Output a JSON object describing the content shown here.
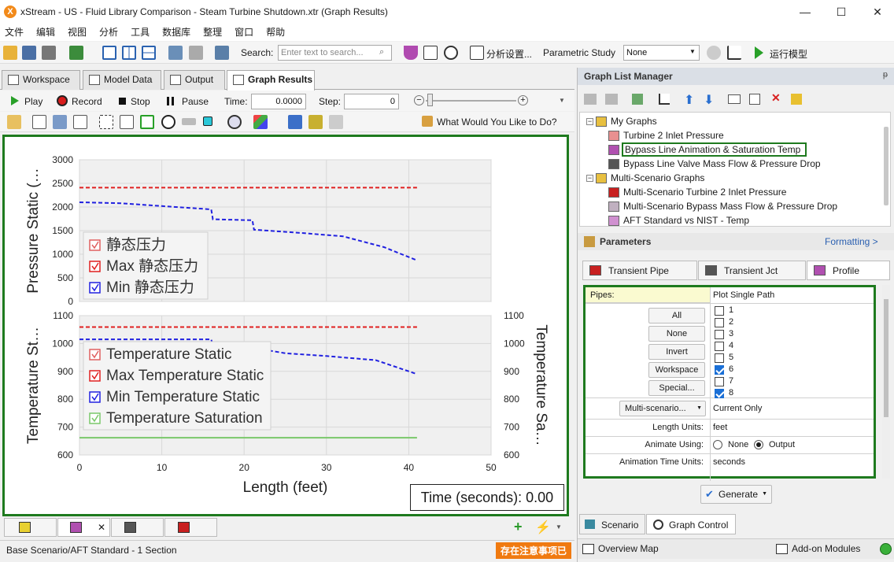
{
  "window": {
    "title": "xStream - US - Fluid Library Comparison - Steam Turbine Shutdown.xtr (Graph Results)",
    "app_icon_letter": "X",
    "min": "—",
    "max": "☐",
    "close": "✕"
  },
  "menu": [
    "文件",
    "编辑",
    "视图",
    "分析",
    "工具",
    "数据库",
    "整理",
    "窗口",
    "帮助"
  ],
  "toolbar": {
    "search_label": "Search:",
    "search_placeholder": "Enter text to search...",
    "analysis_settings": "分析设置...",
    "parametric_label": "Parametric Study",
    "parametric_value": "None",
    "run_model": "运行模型"
  },
  "tabs": [
    {
      "label": "Workspace"
    },
    {
      "label": "Model Data"
    },
    {
      "label": "Output"
    },
    {
      "label": "Graph Results"
    }
  ],
  "playbar": {
    "play": "Play",
    "record": "Record",
    "stop": "Stop",
    "pause": "Pause",
    "time_label": "Time:",
    "time_value": "0.0000",
    "step_label": "Step:",
    "step_value": "0"
  },
  "graph_tools": {
    "help_text": "What Would You Like to Do?"
  },
  "chart_data": [
    {
      "type": "line",
      "ylabel": "Pressure Static (…",
      "ylim": [
        0,
        3000
      ],
      "yticks": [
        "0",
        "500",
        "1000",
        "1500",
        "2000",
        "2500",
        "3000"
      ],
      "xlim": [
        0,
        50
      ],
      "series": [
        {
          "name": "静态压力",
          "color": "#e06060",
          "points": []
        },
        {
          "name": "Max 静态压力",
          "color": "#e02020",
          "points": [
            [
              0,
              2410
            ],
            [
              41,
              2410
            ]
          ]
        },
        {
          "name": "Min 静态压力",
          "color": "#2020e0",
          "points": [
            [
              0,
              2100
            ],
            [
              5,
              2080
            ],
            [
              10,
              2020
            ],
            [
              16,
              1950
            ],
            [
              16.2,
              1740
            ],
            [
              21,
              1720
            ],
            [
              21.2,
              1520
            ],
            [
              27,
              1450
            ],
            [
              32,
              1380
            ],
            [
              37,
              1150
            ],
            [
              41,
              870
            ]
          ]
        }
      ],
      "legend": [
        "静态压力",
        "Max 静态压力",
        "Min 静态压力"
      ]
    },
    {
      "type": "line",
      "ylabel": "Temperature St…",
      "ylabel_right": "Temperature Sa…",
      "ylim": [
        600,
        1100
      ],
      "yticks": [
        "600",
        "700",
        "800",
        "900",
        "1000",
        "1100"
      ],
      "xlim": [
        0,
        50
      ],
      "xticks": [
        "0",
        "10",
        "20",
        "30",
        "40",
        "50"
      ],
      "xlabel": "Length (feet)",
      "series": [
        {
          "name": "Temperature Static",
          "color": "#e06060",
          "points": []
        },
        {
          "name": "Max Temperature Static",
          "color": "#e02020",
          "points": [
            [
              0,
              1059
            ],
            [
              41,
              1059
            ]
          ]
        },
        {
          "name": "Min Temperature Static",
          "color": "#2020e0",
          "points": [
            [
              0,
              1015
            ],
            [
              16,
              1015
            ],
            [
              16.2,
              990
            ],
            [
              21,
              985
            ],
            [
              25,
              965
            ],
            [
              30,
              955
            ],
            [
              36,
              940
            ],
            [
              41,
              890
            ]
          ]
        },
        {
          "name": "Temperature Saturation",
          "color": "#7ac86a",
          "points": [
            [
              0,
              662
            ],
            [
              41,
              662
            ]
          ]
        }
      ],
      "legend": [
        "Temperature Static",
        "Max Temperature Static",
        "Min Temperature Static",
        "Temperature Saturation"
      ]
    }
  ],
  "time_readout": "Time (seconds): 0.00",
  "status": {
    "text": "Base Scenario/AFT Standard - 1 Section",
    "notice": "存在注意事项已"
  },
  "glm": {
    "title": "Graph List Manager",
    "pin": "ᵽ",
    "tree": [
      {
        "label": "My Graphs",
        "level": 0
      },
      {
        "label": "Turbine 2 Inlet Pressure",
        "level": 1
      },
      {
        "label": "Bypass Line Animation & Saturation Temp",
        "level": 1,
        "selected": true
      },
      {
        "label": "Bypass Line Valve Mass Flow & Pressure Drop",
        "level": 1
      },
      {
        "label": "Multi-Scenario Graphs",
        "level": 0
      },
      {
        "label": "Multi-Scenario Turbine 2 Inlet Pressure",
        "level": 1
      },
      {
        "label": "Multi-Scenario Bypass Mass Flow & Pressure Drop",
        "level": 1
      },
      {
        "label": "AFT Standard vs NIST - Temp",
        "level": 1
      }
    ]
  },
  "params": {
    "title": "Parameters",
    "formatting": "Formatting >",
    "tabs": [
      "Transient Pipe",
      "Transient Jct",
      "Profile"
    ],
    "pipes_label": "Pipes:",
    "pipes_value": "Plot Single Path",
    "buttons": [
      "All",
      "None",
      "Invert",
      "Workspace",
      "Special..."
    ],
    "pipes": [
      {
        "label": "1",
        "checked": false
      },
      {
        "label": "2",
        "checked": false
      },
      {
        "label": "3",
        "checked": false
      },
      {
        "label": "4",
        "checked": false
      },
      {
        "label": "5",
        "checked": false
      },
      {
        "label": "6",
        "checked": true
      },
      {
        "label": "7",
        "checked": false
      },
      {
        "label": "8",
        "checked": true
      }
    ],
    "multi_scenario": "Multi-scenario...",
    "multi_value": "Current Only",
    "length_units_label": "Length Units:",
    "length_units_value": "feet",
    "animate_label": "Animate Using:",
    "animate_none": "None",
    "animate_output": "Output",
    "anim_time_label": "Animation Time Units:",
    "anim_time_value": "seconds",
    "generate": "Generate"
  },
  "bottom_right": {
    "scenario": "Scenario",
    "graph_control": "Graph Control",
    "overview_map": "Overview Map",
    "addon": "Add-on Modules"
  }
}
